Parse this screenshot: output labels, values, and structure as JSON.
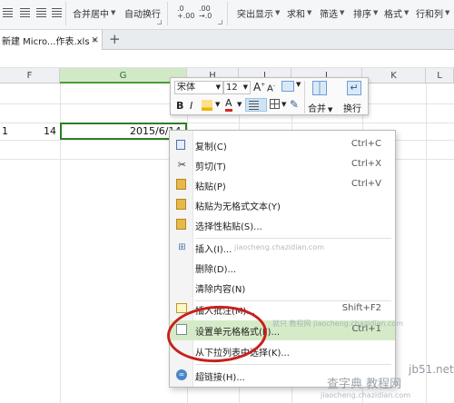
{
  "ribbon": {
    "merge_center": "合并居中",
    "wrap_text": "自动换行",
    "decimal_inc": ".0",
    "decimal_inc_sub": "+.00",
    "decimal_dec": ".00",
    "decimal_dec_sub": "→.0",
    "highlight": "突出显示",
    "sum": "求和",
    "filter": "筛选",
    "sort": "排序",
    "format": "格式",
    "rows_cols": "行和列"
  },
  "tab": {
    "filename": "新建 Micro...作表.xls *",
    "close": "×",
    "new_tab": "+"
  },
  "columns": [
    "F",
    "G",
    "H",
    "I",
    "J",
    "K",
    "L"
  ],
  "row2": {
    "partial_value": "1",
    "f_value": "14",
    "g_value": "2015/6/14"
  },
  "mini_toolbar": {
    "font_name": "宋体",
    "font_size": "12",
    "grow_font": "A",
    "shrink_font": "A",
    "bold": "B",
    "italic": "I",
    "font_color": "A",
    "merge": "合并",
    "wrap": "换行"
  },
  "context_menu": {
    "items": [
      {
        "label": "复制(C)",
        "shortcut": "Ctrl+C",
        "icon": "copy-icon"
      },
      {
        "label": "剪切(T)",
        "shortcut": "Ctrl+X",
        "icon": "cut-icon"
      },
      {
        "label": "粘贴(P)",
        "shortcut": "Ctrl+V",
        "icon": "paste-icon"
      },
      {
        "label": "粘贴为无格式文本(Y)",
        "shortcut": "",
        "icon": "paste-text-icon"
      },
      {
        "label": "选择性粘贴(S)...",
        "shortcut": "",
        "icon": "paste-special-icon"
      },
      {
        "label": "插入(I)...",
        "shortcut": "",
        "icon": "insert-icon"
      },
      {
        "label": "删除(D)...",
        "shortcut": "",
        "icon": ""
      },
      {
        "label": "清除内容(N)",
        "shortcut": "",
        "icon": ""
      },
      {
        "label": "插入批注(M)...",
        "shortcut": "Shift+F2",
        "icon": "comment-icon"
      },
      {
        "label": "设置单元格格式(F)...",
        "shortcut": "Ctrl+1",
        "icon": "format-cells-icon"
      },
      {
        "label": "从下拉列表中选择(K)...",
        "shortcut": "",
        "icon": ""
      },
      {
        "label": "超链接(H)...",
        "shortcut": "",
        "icon": "hyperlink-icon"
      }
    ]
  },
  "watermark": {
    "site1": "查字典 教程网",
    "url1": "jiaocheng.chazidian.com",
    "site2": "jb51.net",
    "overlay1": "jiaocheng.chazidian.com",
    "overlay2": "就只 教程网 jiaocheng.chazidian.com"
  },
  "colors": {
    "accent_green": "#2f7d26",
    "highlight_green": "#d5ebc8",
    "annotation_red": "#c8201c"
  }
}
